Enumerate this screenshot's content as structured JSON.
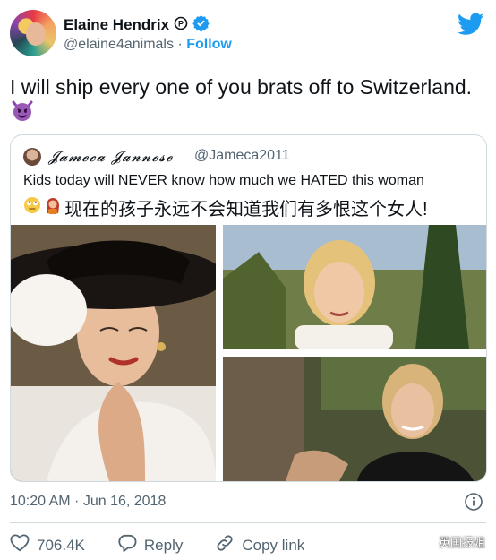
{
  "author": {
    "name": "Elaine Hendrix",
    "handle": "@elaine4animals",
    "separator": "·",
    "follow_label": "Follow"
  },
  "tweet": {
    "text": "I will ship every one of you brats off to Switzerland."
  },
  "quoted": {
    "name": "𝓙𝓪𝓶𝓮𝓬𝓪 𝓙𝓪𝓷𝓷𝓮𝓼𝓮",
    "handle": "@Jameca2011",
    "text": "Kids today will NEVER know how much we HATED this woman",
    "text_cn": "现在的孩子永远不会知道我们有多恨这个女人!"
  },
  "meta": {
    "timestamp": "10:20 AM · Jun 16, 2018"
  },
  "actions": {
    "likes": "706.4K",
    "reply_label": "Reply",
    "copy_label": "Copy link"
  },
  "watermark": {
    "text": "英国报姐"
  },
  "colors": {
    "accent": "#1d9bf0",
    "muted": "#536471",
    "border": "#cfd9de"
  }
}
